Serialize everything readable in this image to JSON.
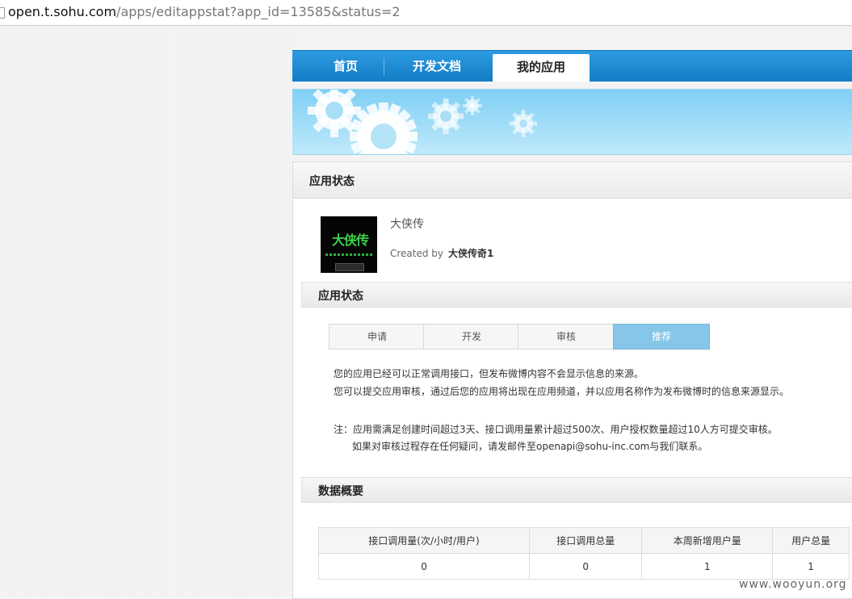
{
  "browser": {
    "url_host": "open.t.sohu.com",
    "url_path": "/apps/editappstat?app_id=13585&status=2"
  },
  "nav": {
    "tabs": [
      {
        "label": "首页"
      },
      {
        "label": "开发文档"
      },
      {
        "label": "我的应用"
      }
    ],
    "active_index": 2
  },
  "page": {
    "title": "应用状态",
    "app_name": "大侠传",
    "created_by_label": "Created by",
    "creator": "大侠传奇1",
    "logo_text": "大侠传"
  },
  "status_section": {
    "title": "应用状态",
    "steps": [
      "申请",
      "开发",
      "审核",
      "推荐"
    ],
    "active_step": 3,
    "message_line1": "您的应用已经可以正常调用接口，但发布微博内容不会显示信息的来源。",
    "message_line2": "您可以提交应用审核，通过后您的应用将出现在应用频道，并以应用名称作为发布微博时的信息来源显示。",
    "note_line1": "注：应用需满足创建时间超过3天、接口调用量累计超过500次、用户授权数量超过10人方可提交审核。",
    "note_line2": "如果对审核过程存在任何疑问，请发邮件至openapi@sohu-inc.com与我们联系。"
  },
  "data_section": {
    "title": "数据概要",
    "columns": [
      "接口调用量(次/小时/用户)",
      "接口调用总量",
      "本周新增用户量",
      "用户总量"
    ],
    "values": [
      "0",
      "0",
      "1",
      "1"
    ]
  },
  "watermark": "www.wooyun.org"
}
